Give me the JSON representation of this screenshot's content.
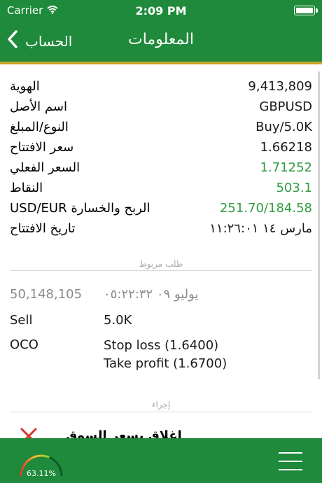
{
  "status_bar": {
    "carrier": "Carrier",
    "time": "2:09 PM"
  },
  "nav": {
    "back_label": "الحساب",
    "title": "المعلومات"
  },
  "info_rows": [
    {
      "label": "الهوية",
      "value": "9,413,809",
      "color": "black"
    },
    {
      "label": "اسم الأصل",
      "value": "GBPUSD",
      "color": "black"
    },
    {
      "label": "النوع/المبلغ",
      "value": "Buy/5.0K",
      "color": "black"
    },
    {
      "label": "سعر الافتتاح",
      "value": "1.66218",
      "color": "black"
    },
    {
      "label": "السعر الفعلي",
      "value": "1.71252",
      "color": "green"
    },
    {
      "label": "النقاط",
      "value": "503.1",
      "color": "green"
    },
    {
      "label": "الربح والخسارة USD/EUR",
      "value": "251.70/184.58",
      "color": "green"
    },
    {
      "label": "تاريخ الافتتاح",
      "value": "مارس ١٤ ١١:٢٦:٠١",
      "color": "black"
    }
  ],
  "linked_order": {
    "section_label": "طلب مربوط",
    "id": "50,148,105",
    "datetime": "يوليو ٠٩ ٠٥:٢٢:٣٢",
    "side": "Sell",
    "amount": "5.0K",
    "type": "OCO",
    "stop_loss": "Stop loss (1.6400)",
    "take_profit": "Take profit (1.6700)"
  },
  "actions": {
    "section_label": "إجراء",
    "close_label": "إغلاق بسعر السوق"
  },
  "tab_bar": {
    "gauge_percent": "63.11%",
    "gauge_value": 0.6311
  },
  "colors": {
    "primary": "#1f8a3b",
    "accent_gold": "#c9a52a",
    "positive": "#2f9b3f",
    "close_red": "#d9342b"
  }
}
